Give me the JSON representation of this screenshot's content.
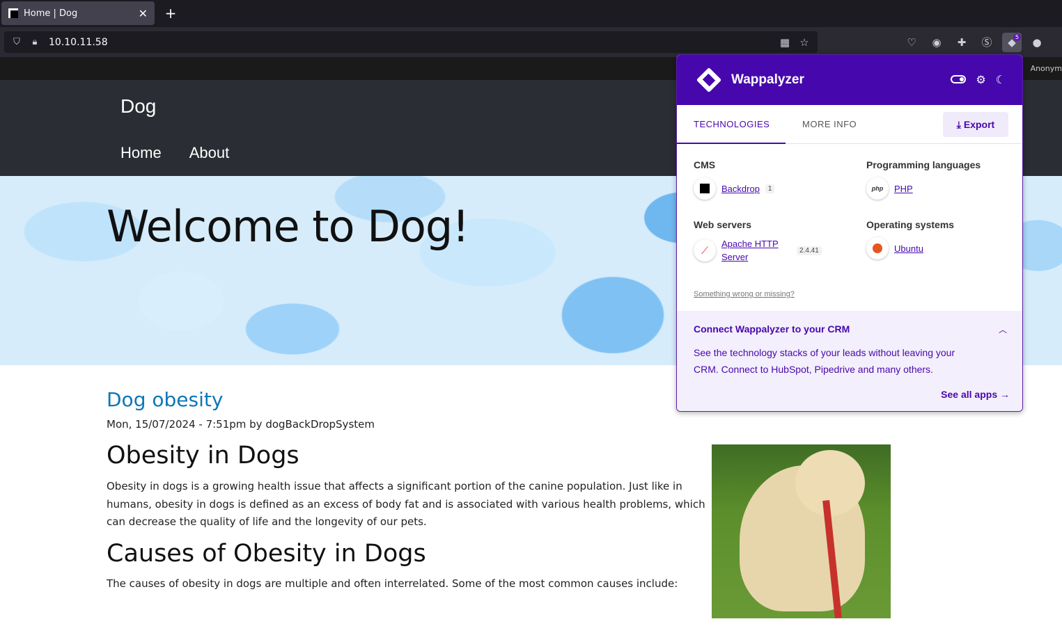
{
  "browser": {
    "tab_title": "Home | Dog",
    "tab_close": "✕",
    "new_tab": "+",
    "url": "10.10.11.58",
    "extension_badge": "5",
    "anon_label": "Anonym"
  },
  "site": {
    "name": "Dog",
    "menu": [
      "Home",
      "About"
    ],
    "hero_title": "Welcome to Dog!",
    "article": {
      "title": "Dog obesity",
      "meta": "Mon, 15/07/2024 - 7:51pm by dogBackDropSystem",
      "h2": "Obesity in Dogs",
      "para": "Obesity in dogs is a growing health issue that affects a significant portion of the canine population. Just like in humans, obesity in dogs is defined as an excess of body fat and is associated with various health problems, which can decrease the quality of life and the longevity of our pets.",
      "h2b": "Causes of Obesity in Dogs",
      "para2": "The causes of obesity in dogs are multiple and often interrelated. Some of the most common causes include:"
    }
  },
  "wappalyzer": {
    "name": "Wappalyzer",
    "tabs": [
      "TECHNOLOGIES",
      "MORE INFO"
    ],
    "export_label": "Export",
    "categories": [
      {
        "title": "CMS",
        "tech": "Backdrop",
        "version": "1",
        "icon": "backdrop-icon"
      },
      {
        "title": "Programming languages",
        "tech": "PHP",
        "version": "",
        "icon": "php-icon",
        "icon_text": "php"
      },
      {
        "title": "Web servers",
        "tech": "Apache HTTP Server",
        "version": "2.4.41",
        "icon": "apache-feather-icon"
      },
      {
        "title": "Operating systems",
        "tech": "Ubuntu",
        "version": "",
        "icon": "ubuntu-icon"
      }
    ],
    "wrong_link": "Something wrong or missing?",
    "crm": {
      "title": "Connect Wappalyzer to your CRM",
      "text": "See the technology stacks of your leads without leaving your CRM. Connect to HubSpot, Pipedrive and many others.",
      "link": "See all apps"
    }
  }
}
